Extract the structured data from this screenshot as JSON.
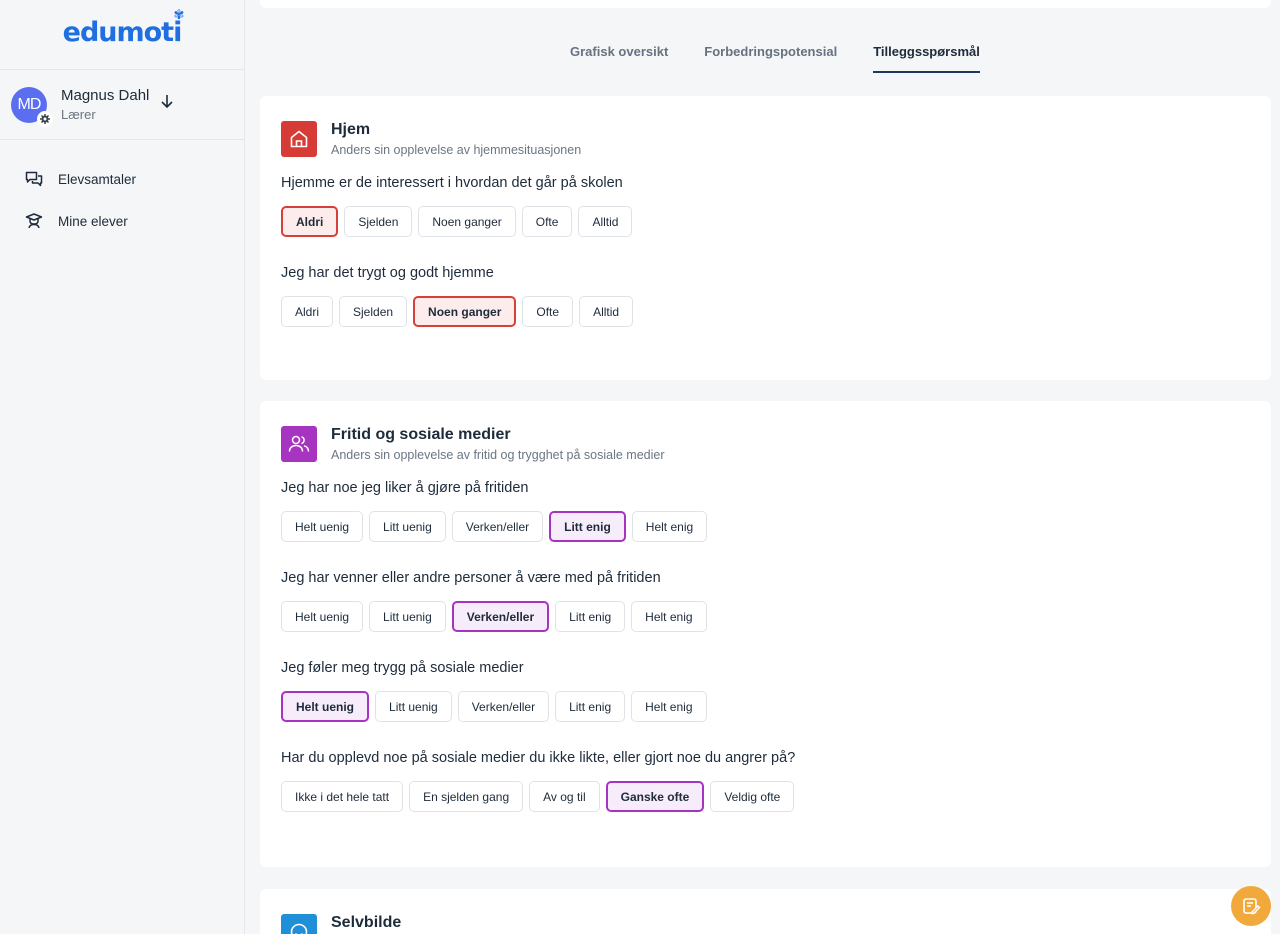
{
  "logo": {
    "text": "edumoti"
  },
  "user": {
    "initials": "MD",
    "name": "Magnus Dahl",
    "role": "Lærer"
  },
  "nav": [
    {
      "label": "Elevsamtaler",
      "icon": "chat-icon"
    },
    {
      "label": "Mine elever",
      "icon": "graduation-icon"
    }
  ],
  "tabs": [
    {
      "label": "Grafisk oversikt",
      "active": false
    },
    {
      "label": "Forbedringspotensial",
      "active": false
    },
    {
      "label": "Tilleggsspørsmål",
      "active": true
    }
  ],
  "colors": {
    "hjem": "#d63b35",
    "fritid": "#a634c0",
    "selvbilde": "#1f8fd8",
    "fab": "#f2a93b"
  },
  "sections": [
    {
      "title": "Hjem",
      "subtitle": "Anders sin opplevelse av hjemmesituasjonen",
      "questions": [
        {
          "text": "Hjemme er de interessert i hvordan det går på skolen",
          "options": [
            "Aldri",
            "Sjelden",
            "Noen ganger",
            "Ofte",
            "Alltid"
          ],
          "selected": "Aldri"
        },
        {
          "text": "Jeg har det trygt og godt hjemme",
          "options": [
            "Aldri",
            "Sjelden",
            "Noen ganger",
            "Ofte",
            "Alltid"
          ],
          "selected": "Noen ganger"
        }
      ]
    },
    {
      "title": "Fritid og sosiale medier",
      "subtitle": "Anders sin opplevelse av fritid og trygghet på sosiale medier",
      "questions": [
        {
          "text": "Jeg har noe jeg liker å gjøre på fritiden",
          "options": [
            "Helt uenig",
            "Litt uenig",
            "Verken/eller",
            "Litt enig",
            "Helt enig"
          ],
          "selected": "Litt enig"
        },
        {
          "text": "Jeg har venner eller andre personer å være med på fritiden",
          "options": [
            "Helt uenig",
            "Litt uenig",
            "Verken/eller",
            "Litt enig",
            "Helt enig"
          ],
          "selected": "Verken/eller"
        },
        {
          "text": "Jeg føler meg trygg på sosiale medier",
          "options": [
            "Helt uenig",
            "Litt uenig",
            "Verken/eller",
            "Litt enig",
            "Helt enig"
          ],
          "selected": "Helt uenig"
        },
        {
          "text": "Har du opplevd noe på sosiale medier du ikke likte, eller gjort noe du angrer på?",
          "options": [
            "Ikke i det hele tatt",
            "En sjelden gang",
            "Av og til",
            "Ganske ofte",
            "Veldig ofte"
          ],
          "selected": "Ganske ofte"
        }
      ]
    },
    {
      "title": "Selvbilde"
    }
  ]
}
